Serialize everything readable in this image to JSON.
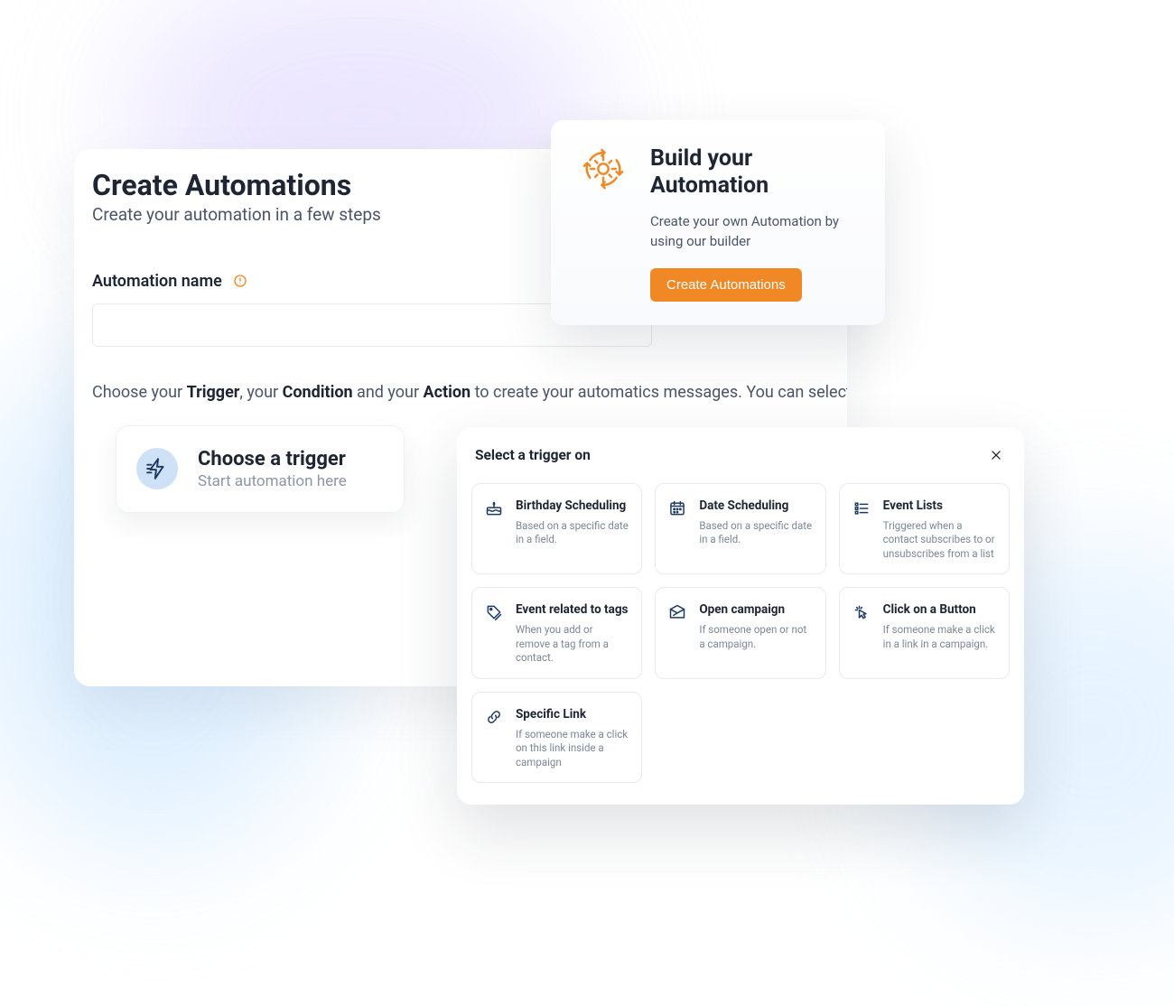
{
  "colors": {
    "accent": "#f08826",
    "blueIcon": "#1f3b63"
  },
  "main": {
    "title": "Create Automations",
    "subtitle": "Create your automation in a few steps",
    "nameLabel": "Automation name",
    "nameValue": "",
    "instruction": {
      "preTrigger": "Choose your ",
      "trigger": "Trigger",
      "midCondition": ", your ",
      "condition": "Condition",
      "midAction": " and your ",
      "action": "Action",
      "post": " to create your automatics messages. You can select several conditions"
    },
    "triggerCard": {
      "title": "Choose a trigger",
      "subtitle": "Start automation here"
    }
  },
  "buildCard": {
    "title": "Build your Automation",
    "description": "Create your own Automation by using our builder",
    "button": "Create Automations"
  },
  "triggerPanel": {
    "title": "Select a trigger on",
    "items": [
      {
        "icon": "birthday-icon",
        "title": "Birthday Scheduling",
        "desc": "Based on a specific date in a field."
      },
      {
        "icon": "calendar-icon",
        "title": "Date Scheduling",
        "desc": "Based on a specific date in a field."
      },
      {
        "icon": "list-icon",
        "title": "Event Lists",
        "desc": "Triggered when a contact subscribes to or unsubscribes from a list"
      },
      {
        "icon": "tag-icon",
        "title": "Event related to tags",
        "desc": "When you add or remove a tag from a contact."
      },
      {
        "icon": "envelope-icon",
        "title": "Open campaign",
        "desc": "If someone open or not a campaign."
      },
      {
        "icon": "click-icon",
        "title": "Click on a Button",
        "desc": "If someone make a click in a link in a campaign."
      },
      {
        "icon": "link-icon",
        "title": "Specific Link",
        "desc": "If someone make a click on this link inside a campaign"
      }
    ]
  }
}
